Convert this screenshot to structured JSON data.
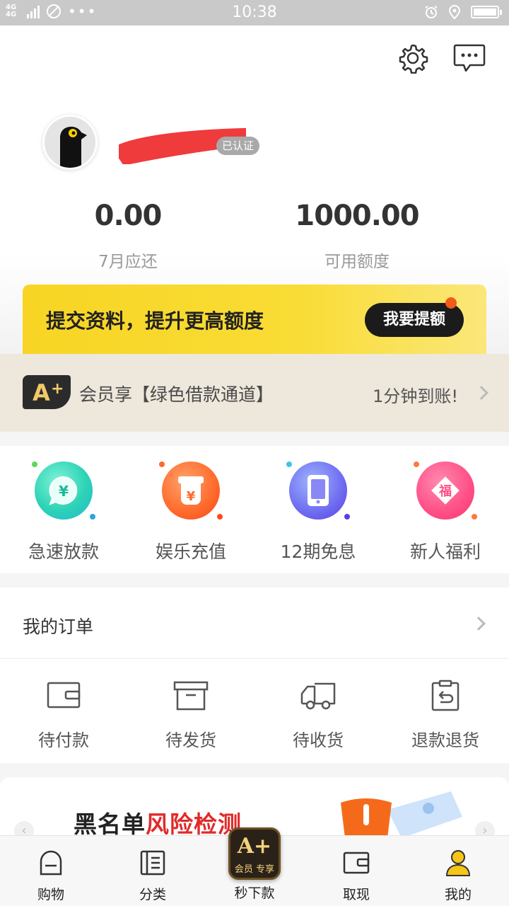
{
  "status_bar": {
    "time": "10:38",
    "network": "4G 4G"
  },
  "profile": {
    "verified_label": "已认证",
    "left_stat": {
      "value": "0.00",
      "label": "7月应还"
    },
    "right_stat": {
      "value": "1000.00",
      "label": "可用额度"
    }
  },
  "banner": {
    "text": "提交资料，提升更高额度",
    "button": "我要提额"
  },
  "member": {
    "badge": "A+",
    "text": "会员享【绿色借款通道】",
    "right_text": "1分钟到账!"
  },
  "quick_actions": [
    {
      "label": "急速放款",
      "icon": "yen-chat-icon",
      "color": "#2dd3b5"
    },
    {
      "label": "娱乐充值",
      "icon": "yen-bag-icon",
      "color": "#ff6a2b"
    },
    {
      "label": "12期免息",
      "icon": "phone-icon",
      "color": "#6e6cf0"
    },
    {
      "label": "新人福利",
      "icon": "fu-envelope-icon",
      "color": "#ff4f86"
    }
  ],
  "orders": {
    "title": "我的订单",
    "items": [
      {
        "label": "待付款",
        "icon": "wallet-icon"
      },
      {
        "label": "待发货",
        "icon": "box-icon"
      },
      {
        "label": "待收货",
        "icon": "truck-icon"
      },
      {
        "label": "退款退货",
        "icon": "clipboard-return-icon"
      }
    ]
  },
  "promo": {
    "text_black": "黑名单",
    "text_red": "风险检测"
  },
  "tabbar": {
    "tabs": [
      {
        "label": "购物",
        "icon": "shop-icon"
      },
      {
        "label": "分类",
        "icon": "category-icon"
      },
      {
        "label": "秒下款",
        "icon": "vip-aplus-icon"
      },
      {
        "label": "取现",
        "icon": "wallet-icon"
      },
      {
        "label": "我的",
        "icon": "person-icon"
      }
    ],
    "center_badge": "A+",
    "center_sub": "会员 专享",
    "active_color": "#f5c518"
  },
  "colors": {
    "banner_yellow": "#f8d524",
    "accent_orange": "#f05a1a",
    "member_bg": "#ede7dc",
    "promo_red": "#e02b2b"
  }
}
